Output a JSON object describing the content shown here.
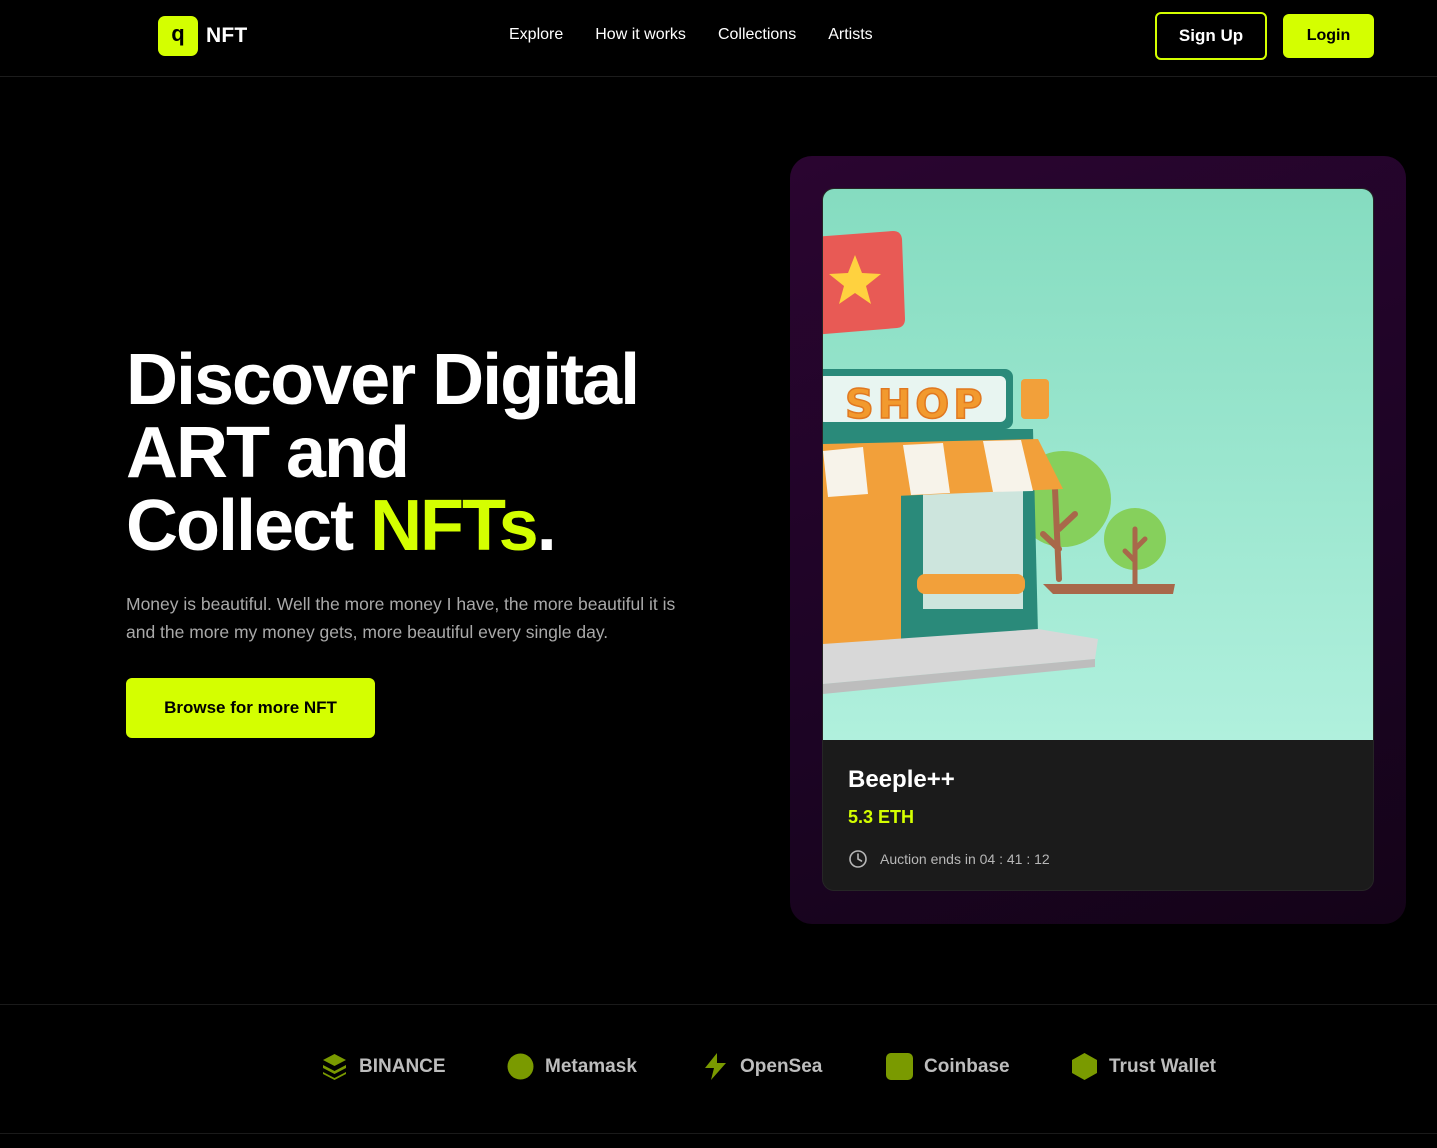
{
  "brand": {
    "mark": "q",
    "name": "NFT",
    "accent": "#d4ff00"
  },
  "nav": {
    "links": [
      "Explore",
      "How it works",
      "Collections",
      "Artists"
    ],
    "signup_label": "Sign Up",
    "login_label": "Login"
  },
  "hero": {
    "title_line1": "Discover Digital",
    "title_line2": "ART and",
    "title_line3_prefix": "Collect ",
    "title_line3_accent": "NFTs",
    "title_line3_suffix": ".",
    "description": "Money is beautiful. Well the more money I have, the more beautiful it is and the more my money gets, more beautiful every single day.",
    "cta_label": "Browse for more NFT"
  },
  "card": {
    "shop_sign": "SHOP",
    "name": "Beeple++",
    "price": "5.3 ETH",
    "auction_text": "Auction ends in 04 : 41 : 12",
    "art_background": "#8fe3c4"
  },
  "partners": [
    {
      "name": "BINANCE",
      "icon": "binance-icon"
    },
    {
      "name": "Metamask",
      "icon": "metamask-icon"
    },
    {
      "name": "OpenSea",
      "icon": "opensea-icon"
    },
    {
      "name": "Coinbase",
      "icon": "coinbase-icon"
    },
    {
      "name": "Trust Wallet",
      "icon": "trust-wallet-icon"
    }
  ],
  "colors": {
    "partner_icon": "#7a9a00",
    "glow": "#2a0530"
  }
}
